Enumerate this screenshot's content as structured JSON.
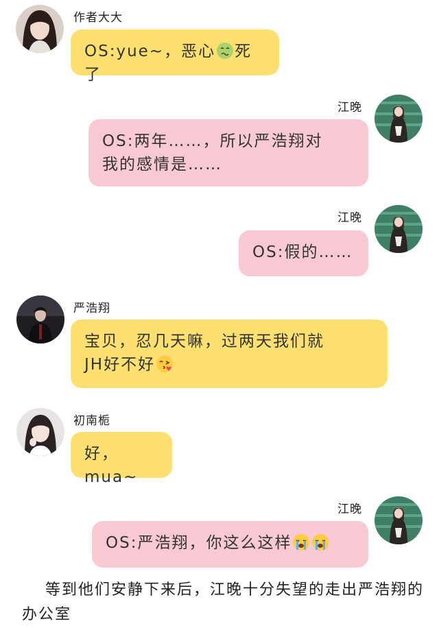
{
  "messages": [
    {
      "sender": "作者大大",
      "side": "left",
      "color": "yellow",
      "text_before": "OS:yue~，恶心",
      "emoji": "nauseated-face-icon",
      "text_after": "死了"
    },
    {
      "sender": "江晚",
      "side": "right",
      "color": "pink",
      "line1": "OS:两年……，所以严浩翔对",
      "line2": "我的感情是……"
    },
    {
      "sender": "江晚",
      "side": "right",
      "color": "pink",
      "text": "OS:假的……"
    },
    {
      "sender": "严浩翔",
      "side": "left",
      "color": "yellow",
      "line1": "宝贝，忍几天嘛，过两天我们就",
      "line2": "JH好不好",
      "emoji": "face-blowing-kiss-icon"
    },
    {
      "sender": "初南栀",
      "side": "left",
      "color": "yellow",
      "text": "好，mua~"
    },
    {
      "sender": "江晚",
      "side": "right",
      "color": "pink",
      "text": "OS:严浩翔，你这么这样",
      "emojis": [
        "loudly-crying-face-icon",
        "loudly-crying-face-icon"
      ]
    }
  ],
  "narration": "等到他们安静下来后，江晚十分失望的走出严浩翔的办公室",
  "colors": {
    "yellow_bubble": "#fde06f",
    "pink_bubble": "#f9c9d4"
  }
}
